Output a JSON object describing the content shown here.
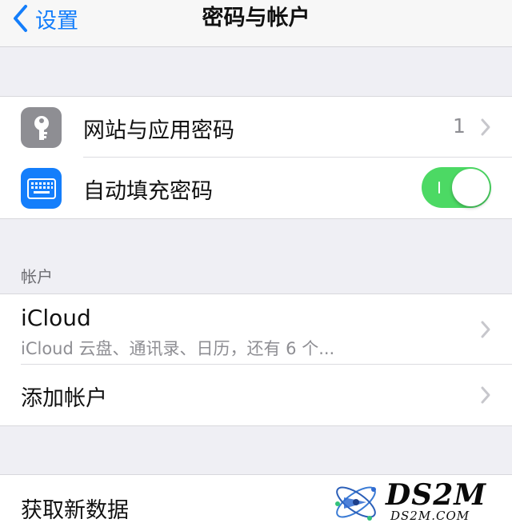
{
  "nav": {
    "back_label": "设置",
    "title": "密码与帐户"
  },
  "passwords": {
    "website_passwords": {
      "label": "网站与应用密码",
      "count": "1",
      "icon": "key-icon"
    },
    "autofill": {
      "label": "自动填充密码",
      "enabled": true,
      "icon": "keyboard-icon"
    }
  },
  "accounts": {
    "header": "帐户",
    "icloud": {
      "title": "iCloud",
      "subtitle": "iCloud 云盘、通讯录、日历，还有 6 个..."
    },
    "add_account": "添加帐户"
  },
  "fetch": {
    "label": "获取新数据"
  },
  "watermark": {
    "main": "DS2M",
    "sub": "DS2M.COM"
  },
  "colors": {
    "accent": "#147efb",
    "toggle_on": "#4cd964",
    "key_icon_bg": "#8e8e93",
    "keyboard_icon_bg": "#147efb",
    "background": "#efeff4"
  }
}
